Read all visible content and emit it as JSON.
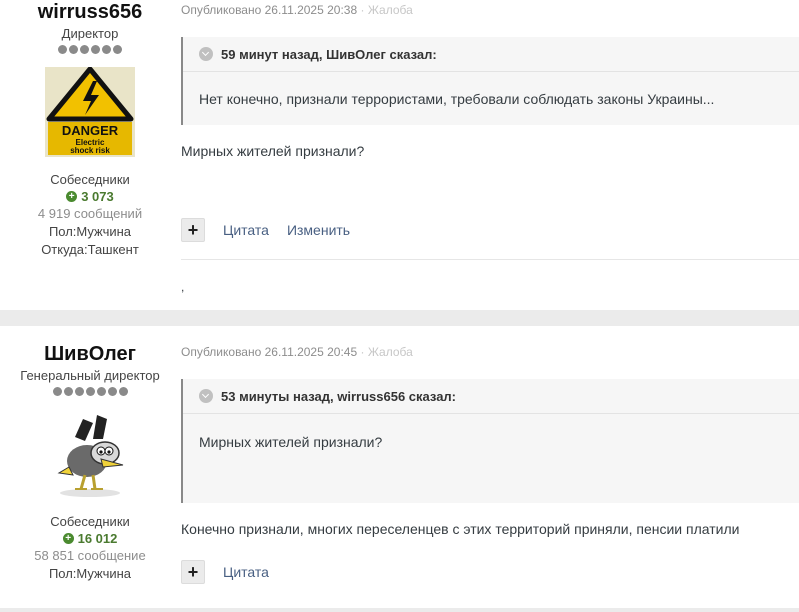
{
  "posts": [
    {
      "author": {
        "name": "wirruss656",
        "rank": "Директор",
        "pips": 6,
        "avatar_caption_line1": "DANGER",
        "avatar_caption_line2": "Electric",
        "avatar_caption_line3": "shock risk",
        "group": "Собеседники",
        "reputation": "3 073",
        "post_count": "4 919 сообщений",
        "gender": "Пол:Мужчина",
        "location": "Откуда:Ташкент"
      },
      "posted": "Опубликовано 26.11.2025 20:38",
      "report": "· Жалоба",
      "quote": {
        "header": "59 минут назад, ШивОлег сказал:",
        "text": "Нет конечно, признали террористами, требовали соблюдать законы Украины..."
      },
      "text": "Мирных жителей признали?",
      "actions": {
        "quote": "Цитата",
        "edit": "Изменить"
      },
      "signature": ","
    },
    {
      "author": {
        "name": "ШивОлег",
        "rank": "Генеральный директор",
        "pips": 7,
        "group": "Собеседники",
        "reputation": "16 012",
        "post_count": "58 851 сообщение",
        "gender": "Пол:Мужчина"
      },
      "posted": "Опубликовано 26.11.2025 20:45",
      "report": "· Жалоба",
      "quote": {
        "header": "53 минуты назад, wirruss656 сказал:",
        "text": "Мирных жителей признали?"
      },
      "text": "Конечно признали, многих переселенцев с этих территорий приняли, пенсии платили",
      "actions": {
        "quote": "Цитата"
      }
    }
  ],
  "colors": {
    "reputation": "#4a7a2f",
    "link": "#485f82",
    "quote_bg": "#f6f6f6",
    "muted": "#8d8d8d"
  }
}
